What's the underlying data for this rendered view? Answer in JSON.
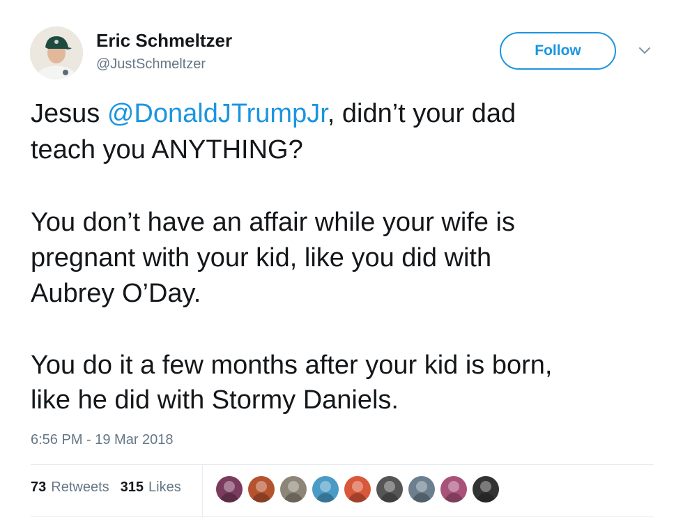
{
  "author": {
    "display_name": "Eric Schmeltzer",
    "handle": "@JustSchmeltzer"
  },
  "actions": {
    "follow_label": "Follow"
  },
  "tweet": {
    "lines": [
      {
        "before": "Jesus ",
        "mention": "@DonaldJTrumpJr",
        "after": ", didn’t your dad"
      },
      {
        "text": "teach you ANYTHING?"
      },
      {
        "text": "You don’t have an affair while your wife is"
      },
      {
        "text": "pregnant with your kid, like you did with"
      },
      {
        "text": "Aubrey O’Day."
      },
      {
        "text": "You do it a few months after your kid is born,"
      },
      {
        "text": "like he did with Stormy Daniels."
      }
    ],
    "timestamp": "6:56 PM - 19 Mar 2018"
  },
  "stats": {
    "retweets_count": "73",
    "retweets_label": "Retweets",
    "likes_count": "315",
    "likes_label": "Likes"
  },
  "likers": [
    {
      "color": "#7a3b5e"
    },
    {
      "color": "#b5532f"
    },
    {
      "color": "#8c8578"
    },
    {
      "color": "#4a9bc6"
    },
    {
      "color": "#d9573a"
    },
    {
      "color": "#555555"
    },
    {
      "color": "#6b7f8e"
    },
    {
      "color": "#a8527a"
    },
    {
      "color": "#333333"
    }
  ],
  "colors": {
    "accent": "#1b95e0",
    "secondary_text": "#657786",
    "primary_text": "#14171a"
  }
}
